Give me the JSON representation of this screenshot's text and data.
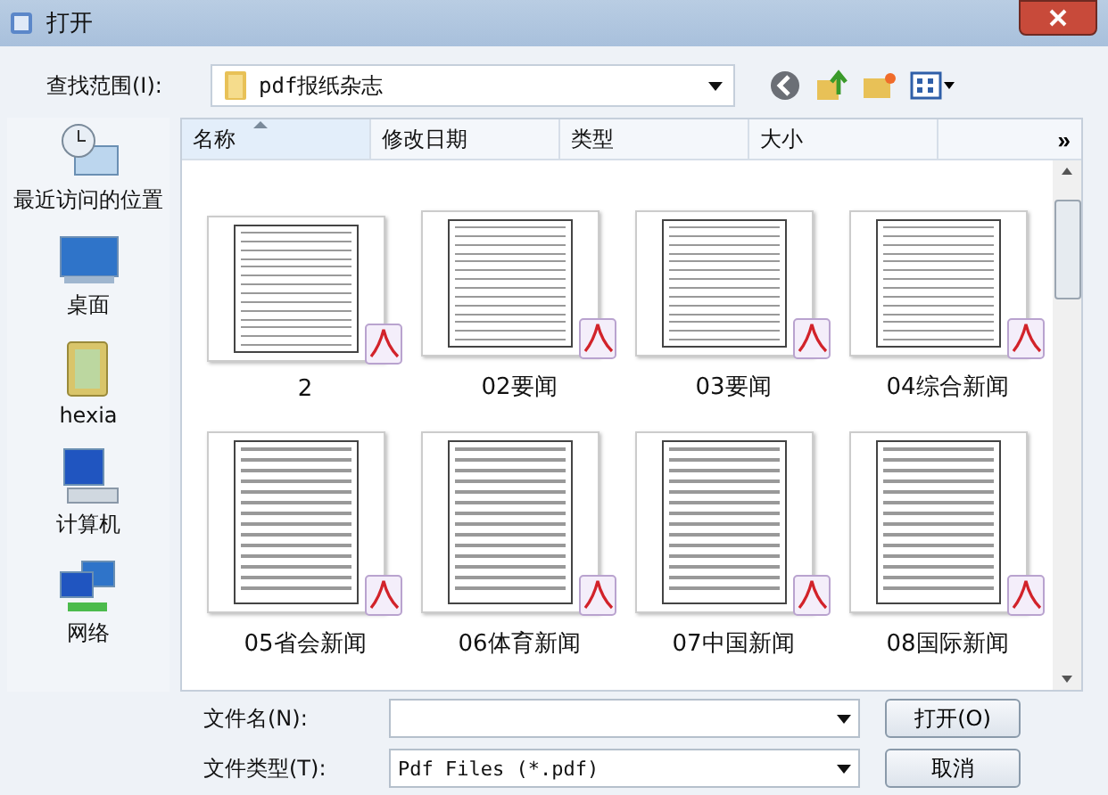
{
  "window": {
    "title": "打开"
  },
  "location": {
    "label": "查找范围(I):",
    "value": "pdf报纸杂志"
  },
  "sidebar": {
    "items": [
      {
        "label": "最近访问的位置",
        "kind": "recent"
      },
      {
        "label": "桌面",
        "kind": "desktop"
      },
      {
        "label": "hexia",
        "kind": "user"
      },
      {
        "label": "计算机",
        "kind": "computer"
      },
      {
        "label": "网络",
        "kind": "network"
      }
    ]
  },
  "columns": [
    {
      "label": "名称",
      "sorted": true
    },
    {
      "label": "修改日期",
      "sorted": false
    },
    {
      "label": "类型",
      "sorted": false
    },
    {
      "label": "大小",
      "sorted": false
    }
  ],
  "more": "»",
  "files": [
    {
      "name": "2"
    },
    {
      "name": "02要闻"
    },
    {
      "name": "03要闻"
    },
    {
      "name": "04综合新闻"
    },
    {
      "name": "05省会新闻"
    },
    {
      "name": "06体育新闻"
    },
    {
      "name": "07中国新闻"
    },
    {
      "name": "08国际新闻"
    }
  ],
  "filename": {
    "label": "文件名(N):"
  },
  "filetype": {
    "label": "文件类型(T):",
    "value": "Pdf Files (*.pdf)"
  },
  "buttons": [
    "打开(O)",
    "取消"
  ]
}
